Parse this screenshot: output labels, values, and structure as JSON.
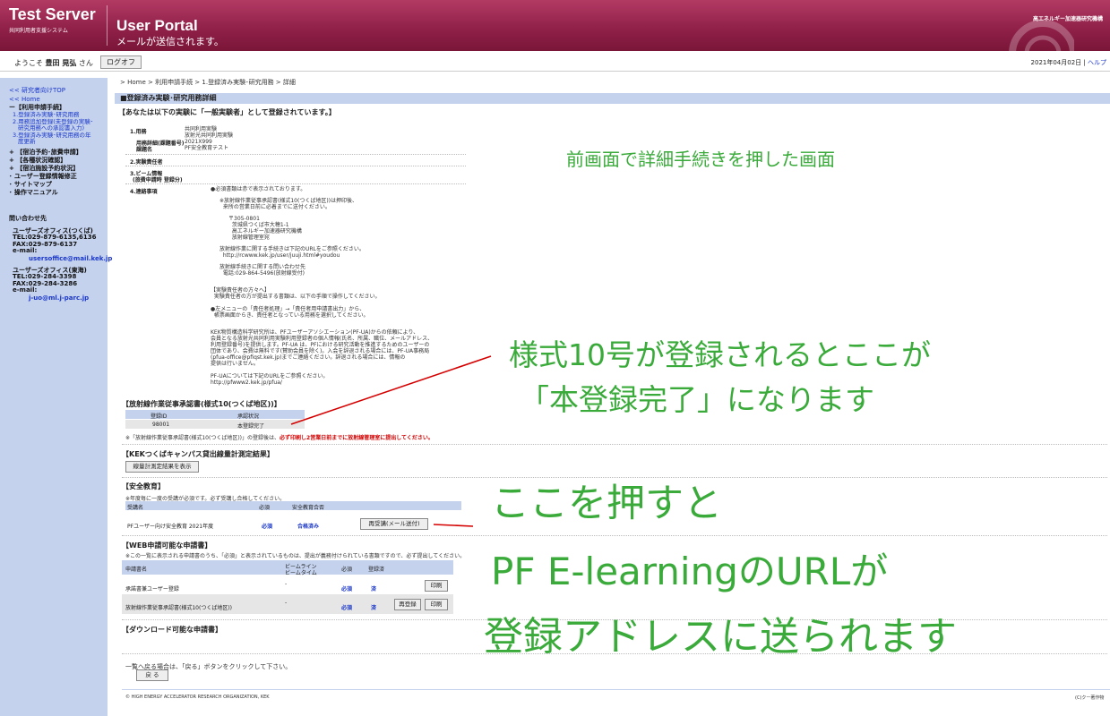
{
  "header": {
    "logo_title": "Test Server",
    "logo_sub": "共同利用者支援システム",
    "portal_title": "User Portal",
    "portal_msg": "メールが送信されます。",
    "org_name": "高エネルギー加速器研究機構"
  },
  "userbar": {
    "welcome_prefix": "ようこそ",
    "user_name": "豊田 晃弘",
    "welcome_suffix": "さん",
    "logout_label": "ログオフ",
    "date": "2021年04月02日",
    "separator": "|",
    "help_label": "ヘルプ"
  },
  "sidebar": {
    "top_link": "<< 研究者向けTOP",
    "home_link": "<< Home",
    "section_apply": "ー【利用申請手続】",
    "sub_items": [
      "1.登録済み実験･研究用務",
      "2.用務追加登録(未登録の実験･",
      "研究用務への承認書入力)",
      "3.登録済み実験･研究用務の年",
      "度更新"
    ],
    "sections": [
      "+ 【宿泊予約･旅費申請】",
      "+ 【各種状況確認】",
      "+ 【宿泊施設予約状況】",
      "･ ユーザー登録情報修正",
      "･ サイトマップ",
      "･ 操作マニュアル"
    ],
    "contact_title": "問い合わせ先",
    "contact1": [
      "ユーザーズオフィス(つくば)",
      "TEL:029-879-6135,6136",
      "FAX:029-879-6137",
      "e-mail:"
    ],
    "contact1_mail": "usersoffice@mail.kek.jp",
    "contact2": [
      "ユーザーズオフィス(東海)",
      "TEL:029-284-3398",
      "FAX:029-284-3286",
      "e-mail:"
    ],
    "contact2_mail": "j-uo@ml.j-parc.jp"
  },
  "main": {
    "breadcrumb": "> Home > 利用申請手続 > 1.登録済み実験･研究用務 > 詳細",
    "section_title": "■登録済み実験･研究用務詳細",
    "registered_as": "【あなたは以下の実験に「一般実験者」として登録されています。】",
    "rows": [
      {
        "label": "1.用務",
        "values": [
          "共同利用実験",
          "放射光共同利用実験",
          "2021X999",
          "PF安全教育テスト"
        ]
      },
      {
        "label": "用務詳細(課題番号)",
        "values": []
      },
      {
        "label": "課題名",
        "values": []
      },
      {
        "label": "2.実験責任者",
        "values": []
      },
      {
        "label": "3.ビーム情報",
        "values": []
      },
      {
        "label": "(旅費申請時 登録分)",
        "values": []
      },
      {
        "label": "4.連絡事項",
        "values": []
      }
    ],
    "notes": [
      "●必須書類は赤で表示されております。",
      "※放射線作業従事承認書(様式10(つくば地区))は押印後、",
      "  来所の営業日前に必着までに送付ください。",
      "〒305-0801",
      "  茨城県つくば市大穂1-1",
      "  高エネルギー加速器研究機構",
      "  放射線管理室宛",
      "放射線作業に関する手続きは下記のURLをご参照ください。",
      "  http://rcwww.kek.jp/user/juuji.html#youdou",
      "放射線手続きに関する問い合わせ先",
      "  電話:029-864-5496(放射線受付)",
      "【実験責任者の方々へ】",
      "  実験責任者の方が提出する書類は、以下の手順で操作してください。",
      "●左メニューの「責任者処理」→「責任者用申請書出力」から、",
      "  帳票画面からき、責任者となっている用務を選択してください。",
      "KEK物質構造科学研究所は、PFユーザーアソシエーション(PF-UA)からの依頼により、",
      "会員となる放射光共同利用実験利用登録者の個人情報(氏名、所属、職位、メールアドレス、",
      "利用登録番号)を提供します。PF-UA は、PFにおける研究活動を推進するためのユーザーの",
      "団体であり、会費は無料です(賛助会員を除く)。入会を辞退される場合には、PF-UA事務局",
      "(pfua-office@pfiqst.kek.jp)までご連絡ください。辞退される場合には、情報の",
      "提供は行いません。",
      "PF-UAについては下記のURLをご参照ください。",
      "http://pfwww2.kek.jp/pfua/"
    ],
    "rad_section": "【放射線作業従事承認書(様式10(つくば地区))】",
    "rad_headers": [
      "登録ID",
      "承認状況"
    ],
    "rad_row": [
      "98001",
      "本登録完了"
    ],
    "rad_note_prefix": "※「放射線作業従事承認書(様式10(つくば地区))」の登録後は、",
    "rad_note_red": "必ず印刷し2営業日前までに放射線管理室に提出してください。",
    "kek_section": "【KEKつくばキャンパス貸出線量計測定結果】",
    "kek_button": "線量計測定結果を表示",
    "safety_section": "【安全教育】",
    "safety_note": "※年度毎に一度の受講が必須です。必ず受講し合格してください。",
    "safety_headers": [
      "受講名",
      "必須",
      "安全教育合否"
    ],
    "safety_row": [
      "PFユーザー向け安全教育 2021年度",
      "必須",
      "合格済み"
    ],
    "safety_button": "再受講(メール送付)",
    "web_section": "【WEB申請可能な申請書】",
    "web_note": "※この一覧に表示される申請書のうち、「必須」と表示されているものは、提出が義務付けられている書類ですので、必ず提出してください。",
    "web_headers": [
      "申請書名",
      "ビームライン",
      "必須",
      "登録済"
    ],
    "web_headers_sub": "ビームタイム",
    "web_rows": [
      {
        "name": "承諾書兼ユーザー登録",
        "dash": "-",
        "required": "必須",
        "done": "済",
        "print": "印刷"
      },
      {
        "name": "放射線作業従事承認書(様式10(つくば地区))",
        "dash": "-",
        "required": "必須",
        "done": "済",
        "reregister": "再登録",
        "print": "印刷"
      }
    ],
    "download_section": "【ダウンロード可能な申請書】",
    "back_note": "一覧へ戻る場合は、「戻る」ボタンをクリックして下さい。",
    "back_button": "戻 る",
    "footer": "© HIGH ENERGY ACCELERATOR RESEARCH ORGANIZATION, KEK",
    "footer_right": "(C)クー著作物"
  },
  "annotations": {
    "a1": "前画面で詳細手続きを押した画面",
    "a2_line1": "様式10号が登録されるとここが",
    "a2_line2": "「本登録完了」になります",
    "a3_line1": "ここを押すと",
    "a3_line2": "PF E-learningのURLが",
    "a3_line3": "登録アドレスに送られます",
    "color": "#3aab3a",
    "arrow_color": "#d40000"
  }
}
